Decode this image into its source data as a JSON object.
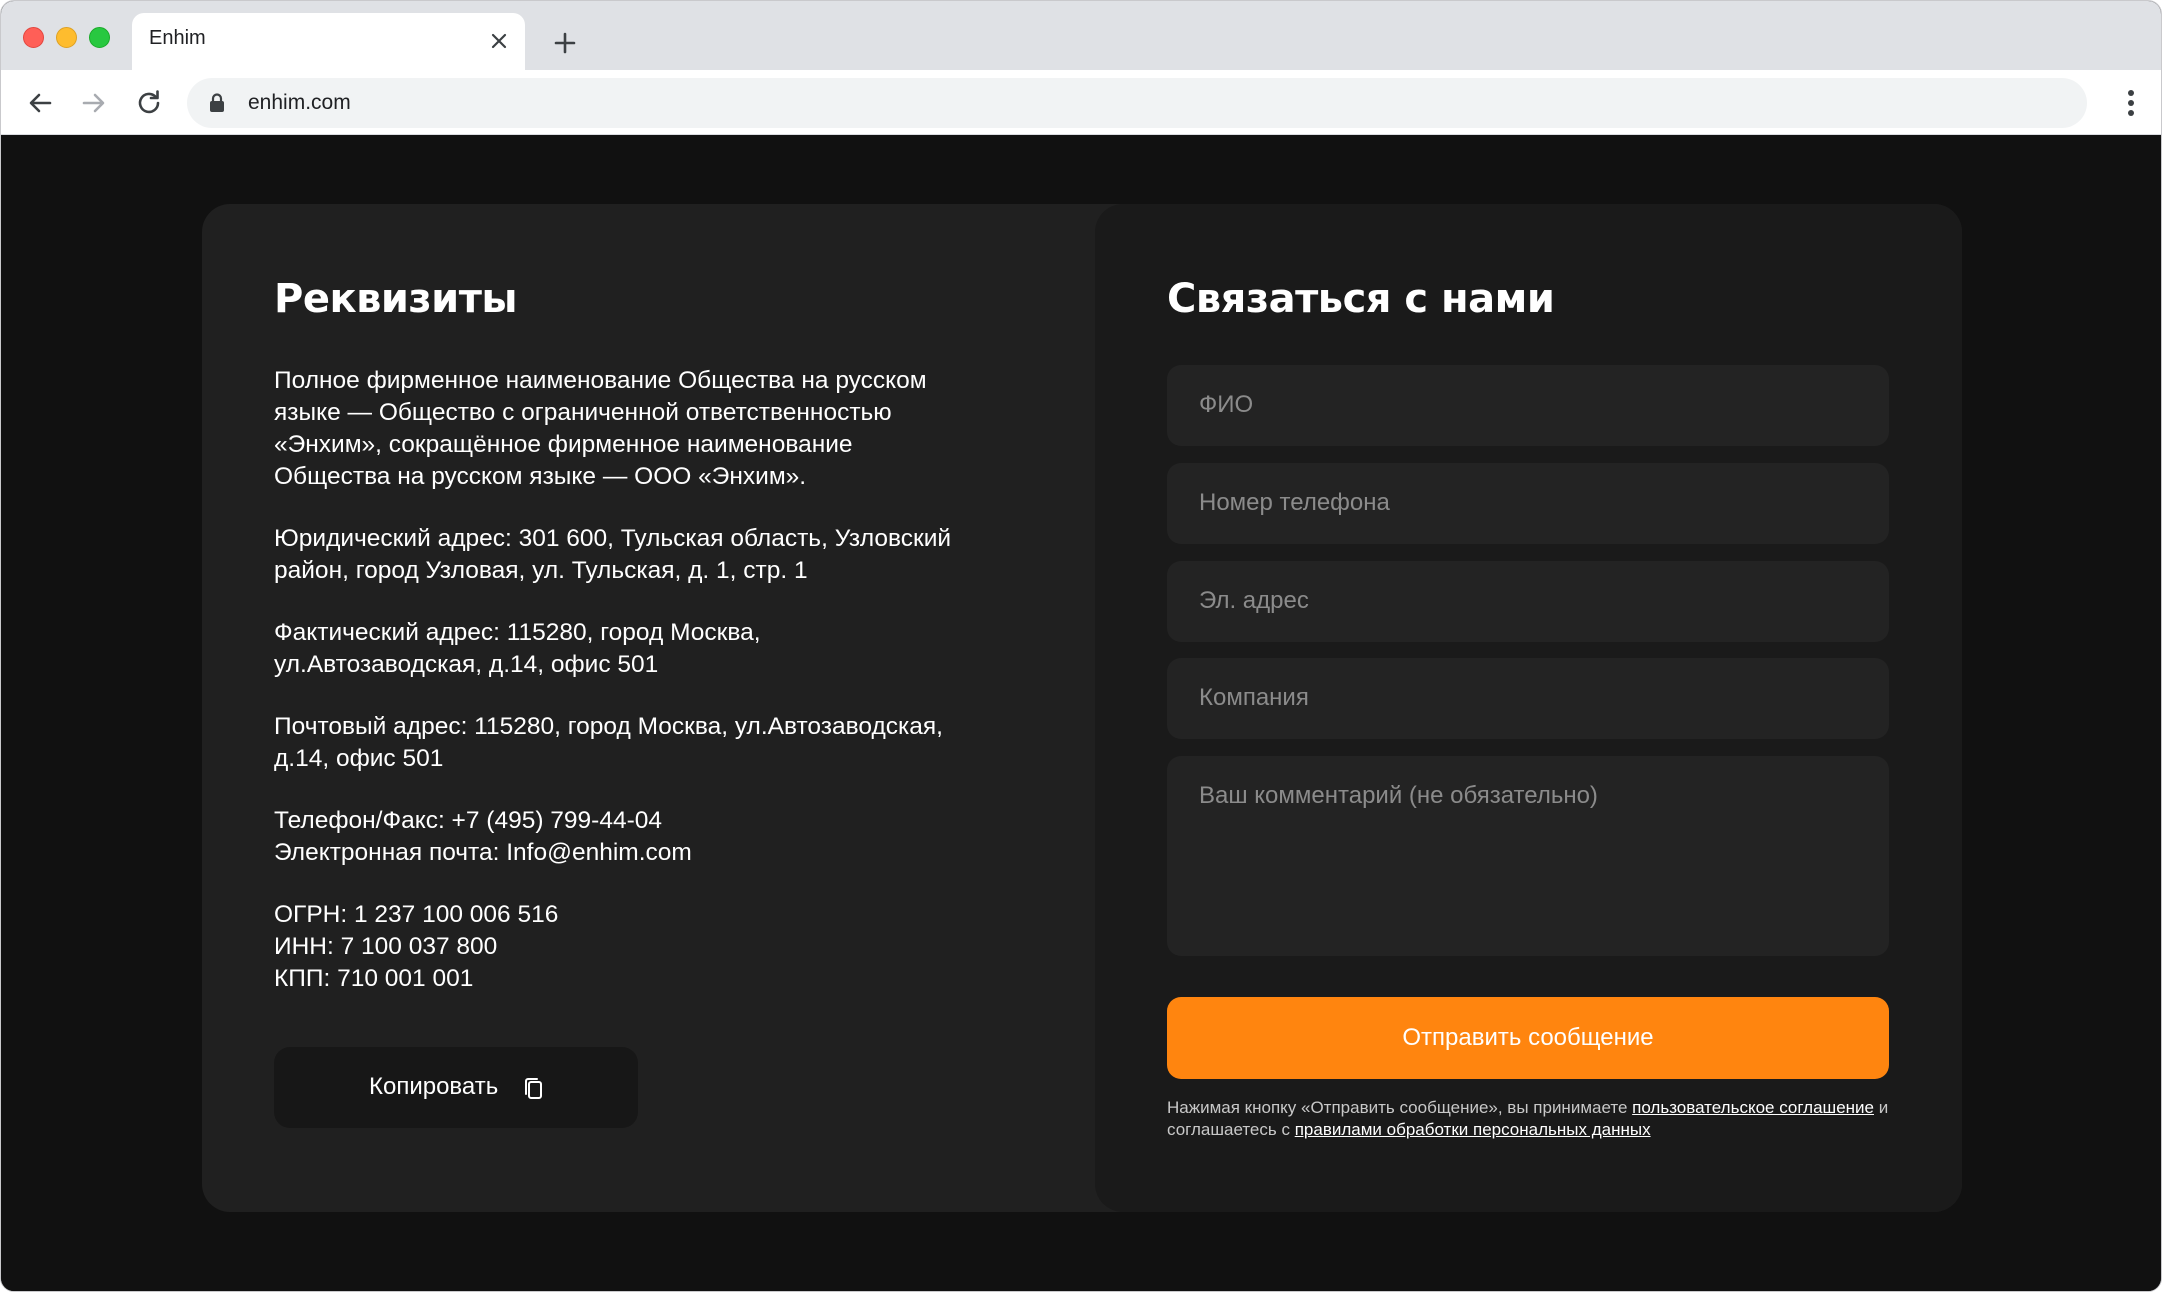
{
  "browser": {
    "tab_title": "Enhim",
    "url": "enhim.com"
  },
  "requisites": {
    "title": "Реквизиты",
    "paragraphs": [
      [
        "Полное фирменное наименование Общества на русском",
        "языке — Общество с ограниченной ответственностью",
        "«Энхим», сокращённое фирменное наименование",
        "Общества на русском языке — ООО «Энхим»."
      ],
      [
        "Юридический адрес: 301 600, Тульская область, Узловский",
        "район, город Узловая, ул. Тульская, д. 1, стр. 1"
      ],
      [
        "Фактический адрес: 115280, город Москва,",
        "ул.Автозаводская, д.14, офис 501"
      ],
      [
        "Почтовый адрес: 115280, город Москва, ул.Автозаводская,",
        "д.14, офис 501"
      ],
      [
        "Телефон/Факс: +7 (495) 799-44-04",
        "Электронная почта: Info@enhim.com"
      ],
      [
        "ОГРН: 1 237 100 006 516",
        "ИНН: 7 100 037 800",
        "КПП: 710 001 001"
      ]
    ],
    "copy_label": "Копировать"
  },
  "contact": {
    "title": "Связаться с нами",
    "fields": {
      "name_placeholder": "ФИО",
      "phone_placeholder": "Номер телефона",
      "email_placeholder": "Эл. адрес",
      "company_placeholder": "Компания",
      "comment_placeholder": "Ваш комментарий (не обязательно)"
    },
    "submit_label": "Отправить сообщение",
    "legal": {
      "prefix": "Нажимая кнопку «Отправить сообщение», вы принимаете",
      "agreement_link": "пользовательское соглашение",
      "middle": "и соглашаетесь с",
      "privacy_link": "правилами обработки персональных данных"
    }
  },
  "colors": {
    "accent": "#ff850f",
    "page_bg": "#111111",
    "card_bg": "#202020",
    "field_bg": "#232323"
  }
}
